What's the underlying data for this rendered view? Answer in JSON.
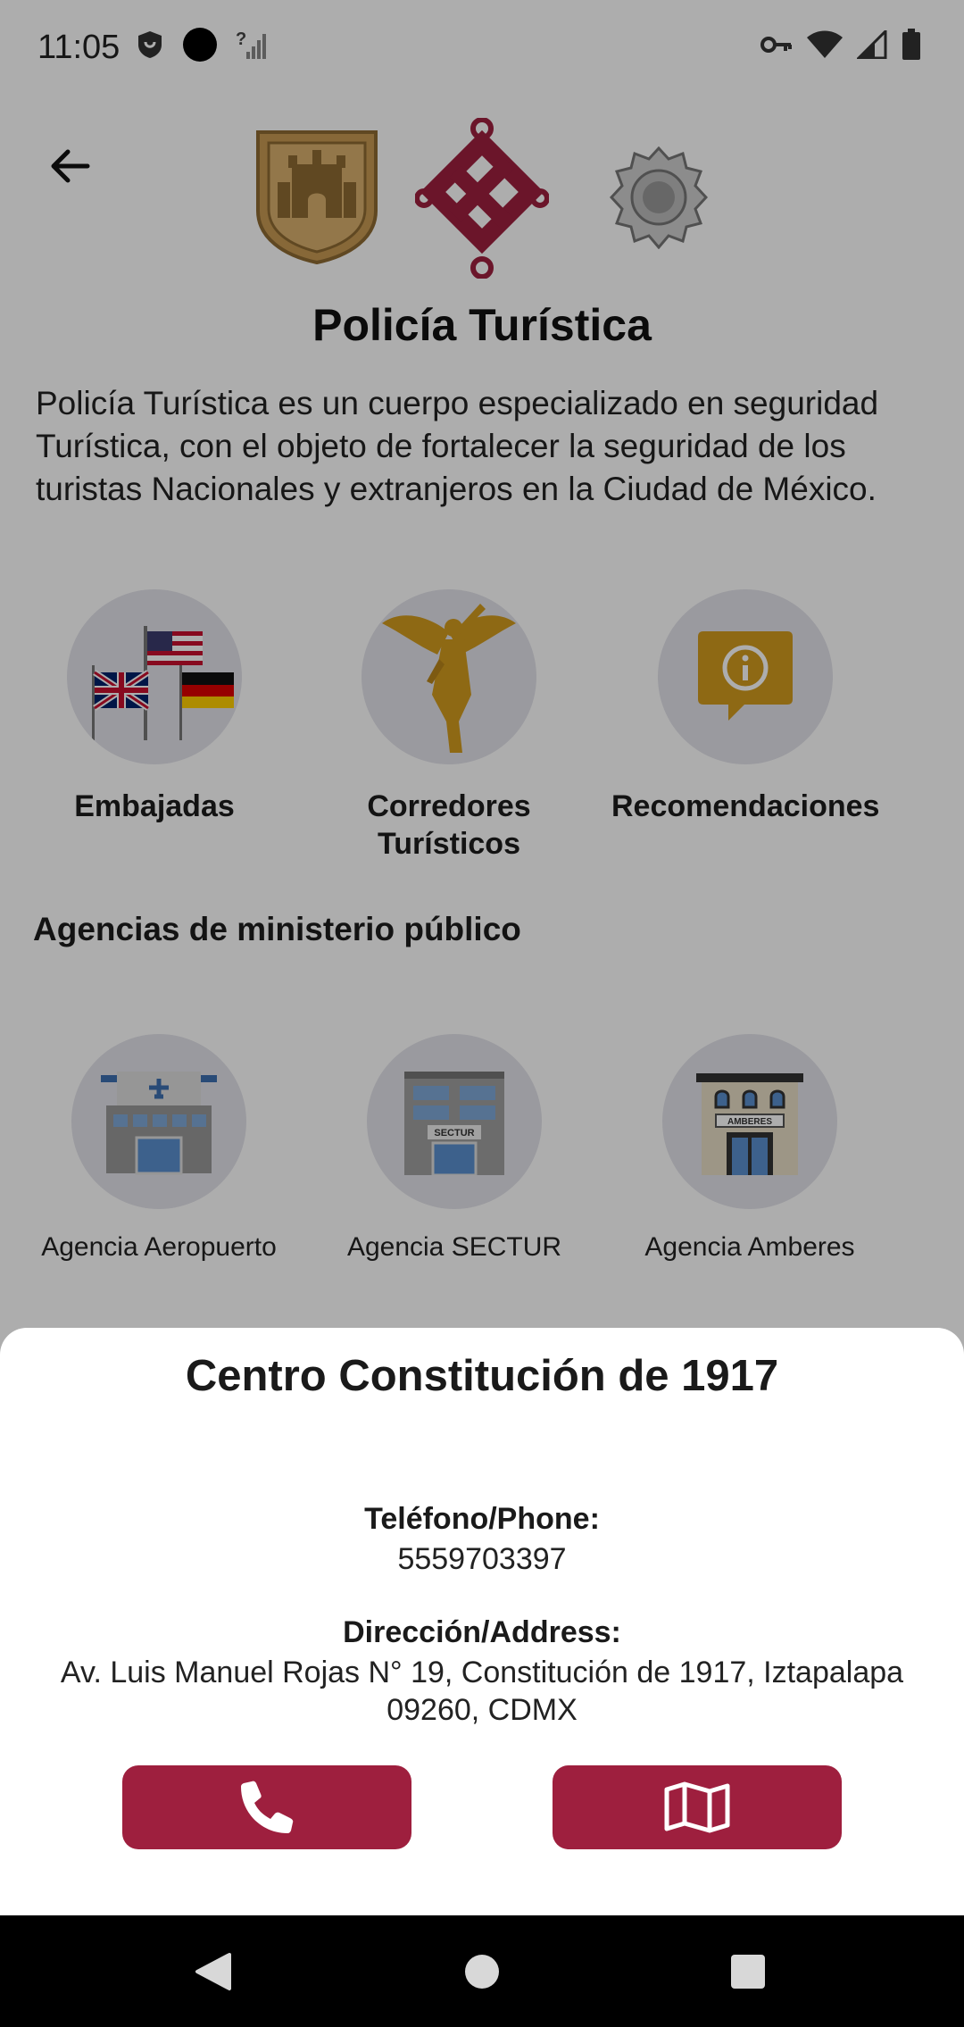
{
  "status_bar": {
    "time": "11:05",
    "left_icons": [
      "shield-icon",
      "circle-icon",
      "signal-unknown-icon"
    ],
    "right_icons": [
      "vpn-key-icon",
      "wifi-icon",
      "cell-signal-icon",
      "battery-icon"
    ]
  },
  "header": {
    "title": "Policía Turística",
    "description": "Policía Turística es un cuerpo especializado en seguridad Turística, con el objeto de fortalecer la seguridad de los turistas Nacionales y extranjeros en la Ciudad de México."
  },
  "categories": [
    {
      "label": "Embajadas",
      "icon": "flags-icon"
    },
    {
      "label": "Corredores Turísticos",
      "icon": "angel-statue-icon"
    },
    {
      "label": "Recomendaciones",
      "icon": "info-bubble-icon"
    }
  ],
  "agencies_section": {
    "title": "Agencias de ministerio público",
    "items": [
      {
        "label": "Agencia Aeropuerto",
        "icon": "airport-building-icon"
      },
      {
        "label": "Agencia SECTUR",
        "icon": "sectur-building-icon",
        "sign": "SECTUR"
      },
      {
        "label": "Agencia Amberes",
        "icon": "amberes-building-icon",
        "sign": "AMBERES"
      }
    ]
  },
  "bottom_sheet": {
    "title": "Centro Constitución de 1917",
    "phone_label": "Teléfono/Phone:",
    "phone_value": "5559703397",
    "address_label": "Dirección/Address:",
    "address_value": "Av. Luis Manuel Rojas N° 19, Constitución de 1917, Iztapalapa 09260, CDMX",
    "call_icon": "phone-icon",
    "map_icon": "map-icon"
  },
  "colors": {
    "brand": "#9e1f3e",
    "circle_bg": "#e3e3ea",
    "gold": "#d29b1e"
  }
}
